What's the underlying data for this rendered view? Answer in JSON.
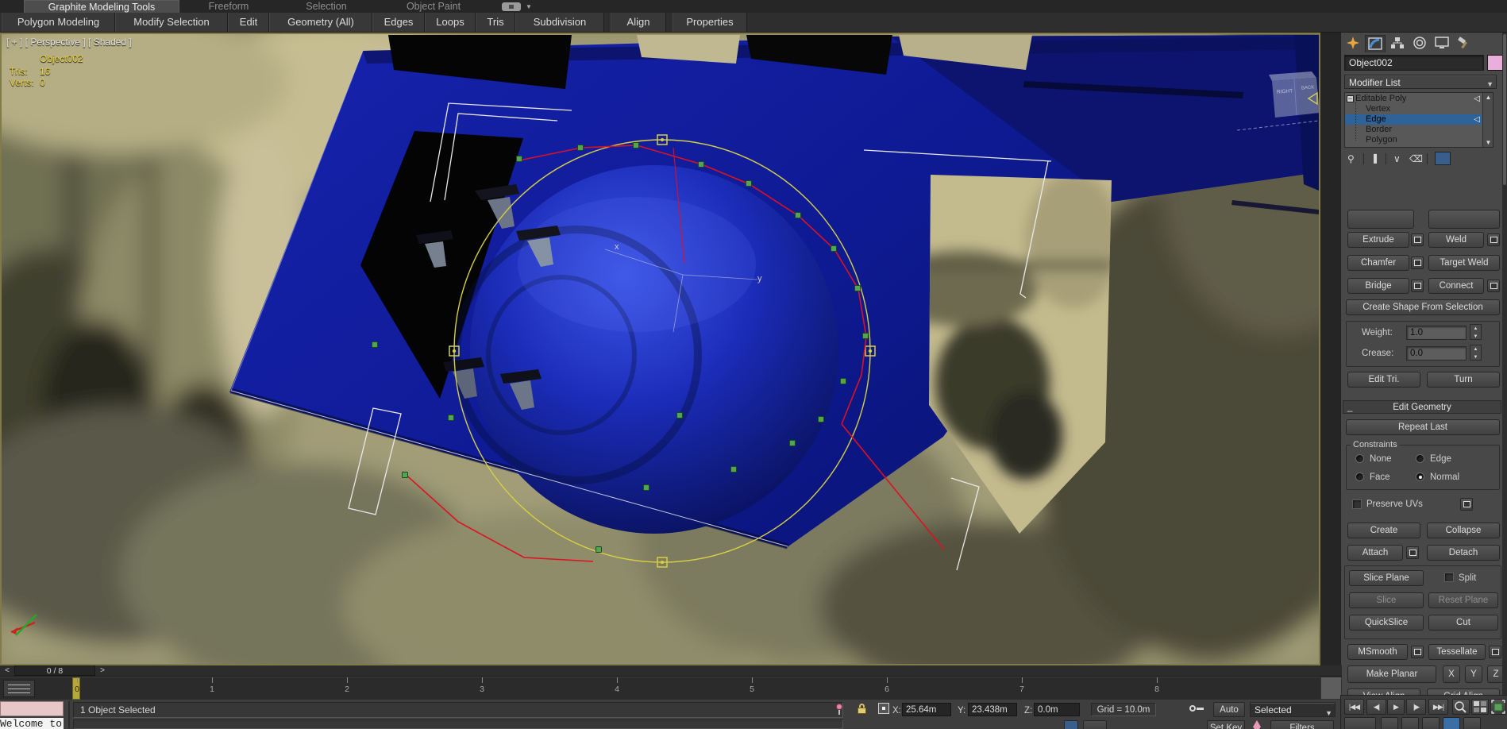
{
  "ribbon": {
    "tabs": [
      "Graphite Modeling Tools",
      "Freeform",
      "Selection",
      "Object Paint"
    ],
    "sections": [
      "Polygon Modeling",
      "Modify Selection",
      "Edit",
      "Geometry (All)",
      "Edges",
      "Loops",
      "Tris",
      "Subdivision",
      "Align",
      "Properties"
    ]
  },
  "viewport": {
    "label": "[ + ] [ Perspective ] [ Shaded ]",
    "object_name": "Object002",
    "tris_label": "Tris:",
    "tris_value": "16",
    "verts_label": "Verts:",
    "verts_value": "0",
    "viewcube_right": "RIGHT",
    "viewcube_back": "BACK",
    "axis_x_label": "x",
    "axis_y_label": "y"
  },
  "command_panel": {
    "object_name_field": "Object002",
    "modifier_list_label": "Modifier List",
    "stack_items": [
      "Editable Poly",
      "Vertex",
      "Edge",
      "Border",
      "Polygon"
    ],
    "edit_edges": {
      "extrude": "Extrude",
      "weld": "Weld",
      "chamfer": "Chamfer",
      "target_weld": "Target Weld",
      "bridge": "Bridge",
      "connect": "Connect",
      "create_shape": "Create Shape From Selection",
      "weight_label": "Weight:",
      "weight_value": "1.0",
      "crease_label": "Crease:",
      "crease_value": "0.0",
      "edit_tri": "Edit Tri.",
      "turn": "Turn"
    },
    "edit_geometry": {
      "title": "Edit Geometry",
      "repeat_last": "Repeat Last",
      "constraints_label": "Constraints",
      "constraint_none": "None",
      "constraint_edge": "Edge",
      "constraint_face": "Face",
      "constraint_normal": "Normal",
      "preserve_uvs": "Preserve UVs",
      "create": "Create",
      "collapse": "Collapse",
      "attach": "Attach",
      "detach": "Detach",
      "slice_plane": "Slice Plane",
      "split": "Split",
      "slice": "Slice",
      "reset_plane": "Reset Plane",
      "quickslice": "QuickSlice",
      "cut": "Cut",
      "msmooth": "MSmooth",
      "tessellate": "Tessellate",
      "make_planar": "Make Planar",
      "axis_x": "X",
      "axis_y": "Y",
      "axis_z": "Z",
      "view_align": "View Align",
      "grid_align": "Grid Align"
    }
  },
  "timeline": {
    "frame_display": "0 / 8",
    "prev_frame": "<",
    "next_frame": ">",
    "ticks": [
      "0",
      "1",
      "2",
      "3",
      "4",
      "5",
      "6",
      "7",
      "8"
    ]
  },
  "status_bar": {
    "status_text": "1 Object Selected",
    "x_label": "X:",
    "x_value": "25.64m",
    "y_label": "Y:",
    "y_value": "23.438m",
    "z_label": "Z:",
    "z_value": "0.0m",
    "grid_label": "Grid = 10.0m",
    "auto_label": "Auto",
    "selected_label": "Selected",
    "set_key_label": "Set Key",
    "filters_label": "Filters",
    "welcome_text": "Welcome to"
  },
  "icons": {
    "go_start": "|◀◀",
    "prev_key": "◀|",
    "play": "▶",
    "next_key": "|▶",
    "go_end": "▶▶|",
    "dropdown": "▼",
    "spin_up": "▲",
    "spin_down": "▼",
    "scroll_up": "▲",
    "scroll_down": "▼",
    "expand_minus": "−",
    "subobject_arrow": "◁",
    "window_min": "_"
  },
  "colors": {
    "accent_selection_blue": "#2e6399",
    "viewport_border_olive": "#837a49",
    "object_blue": "#101d9e",
    "spline_yellow": "#d6cf45",
    "edge_red": "#dd1122",
    "vertex_green": "#53a553",
    "name_swatch_pink": "#eaaedd"
  }
}
